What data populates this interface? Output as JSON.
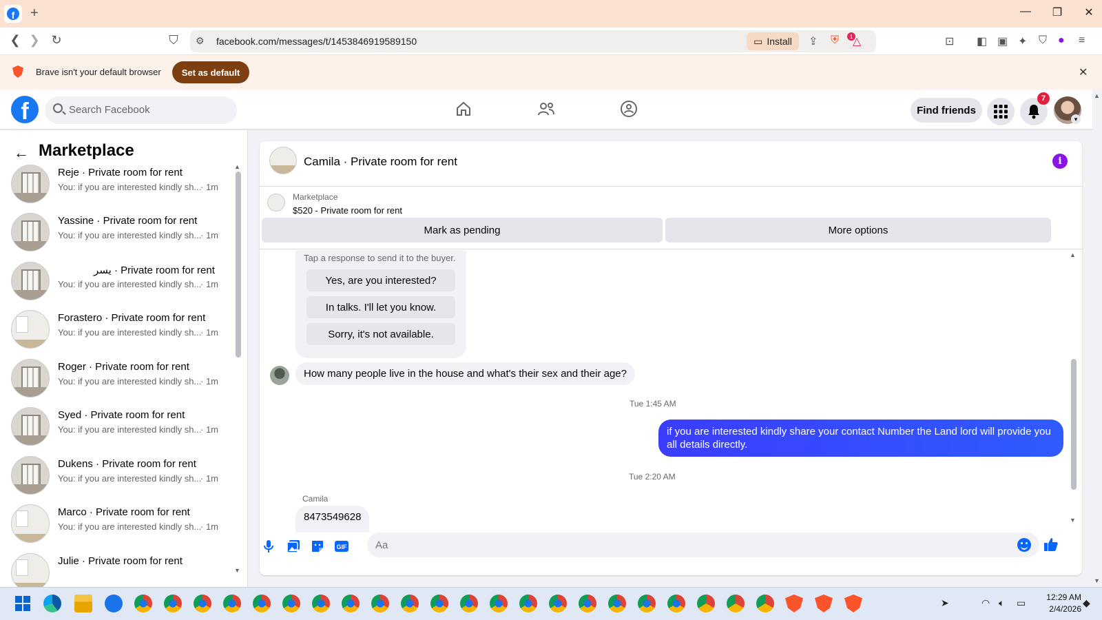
{
  "browser": {
    "url": "facebook.com/messages/t/1453846919589150",
    "install_label": "Install",
    "alert_badge": "1",
    "infobar_text": "Brave isn't your default browser",
    "set_default_label": "Set as default"
  },
  "header": {
    "search_placeholder": "Search Facebook",
    "find_friends_label": "Find friends",
    "notification_count": "7"
  },
  "sidebar": {
    "title": "Marketplace",
    "conversations": [
      {
        "name": "Reje · Private room for rent",
        "preview": "You: if you are interested kindly sh...",
        "time": "· 1m",
        "thumb": "room"
      },
      {
        "name": "Yassine · Private room for rent",
        "preview": "You: if you are interested kindly sh...",
        "time": "· 1m",
        "thumb": "room"
      },
      {
        "name": "يسر · Private room for rent",
        "preview": "You: if you are interested kindly sh...",
        "time": "· 1m",
        "thumb": "room"
      },
      {
        "name": "Forastero · Private room for rent",
        "preview": "You: if you are interested kindly sh...",
        "time": "· 1m",
        "thumb": "alt"
      },
      {
        "name": "Roger · Private room for rent",
        "preview": "You: if you are interested kindly sh...",
        "time": "· 1m",
        "thumb": "room"
      },
      {
        "name": "Syed · Private room for rent",
        "preview": "You: if you are interested kindly sh...",
        "time": "· 1m",
        "thumb": "room"
      },
      {
        "name": "Dukens · Private room for rent",
        "preview": "You: if you are interested kindly sh...",
        "time": "· 1m",
        "thumb": "room"
      },
      {
        "name": "Marco · Private room for rent",
        "preview": "You: if you are interested kindly sh...",
        "time": "· 1m",
        "thumb": "alt"
      },
      {
        "name": "Julie · Private room for rent",
        "preview": "",
        "time": "",
        "thumb": "alt"
      }
    ]
  },
  "chat": {
    "title": "Camila · Private room for rent",
    "listing": {
      "source": "Marketplace",
      "title": "$520 - Private room for rent",
      "mark_pending_label": "Mark as pending",
      "more_options_label": "More options"
    },
    "quick_responses": {
      "hint": "Tap a response to send it to the buyer.",
      "options": [
        "Yes, are you interested?",
        "In talks. I'll let you know.",
        "Sorry, it's not available."
      ]
    },
    "incoming_1": "How many people live in the house and what's their sex and their age?",
    "timestamp_1": "Tue 1:45 AM",
    "outgoing_1": "if you are interested kindly share your contact Number the Land lord will provide you all details directly.",
    "timestamp_2": "Tue 2:20 AM",
    "sender_name": "Camila",
    "incoming_2": "8473549628",
    "composer_placeholder": "Aa"
  },
  "taskbar": {
    "time": "12:29 AM",
    "date": "2/4/2026"
  },
  "colors": {
    "facebook_blue": "#1877f2",
    "outgoing_bubble": "#3646ff",
    "brave_button": "#7d3e10",
    "notification_red": "#e41e3f"
  }
}
